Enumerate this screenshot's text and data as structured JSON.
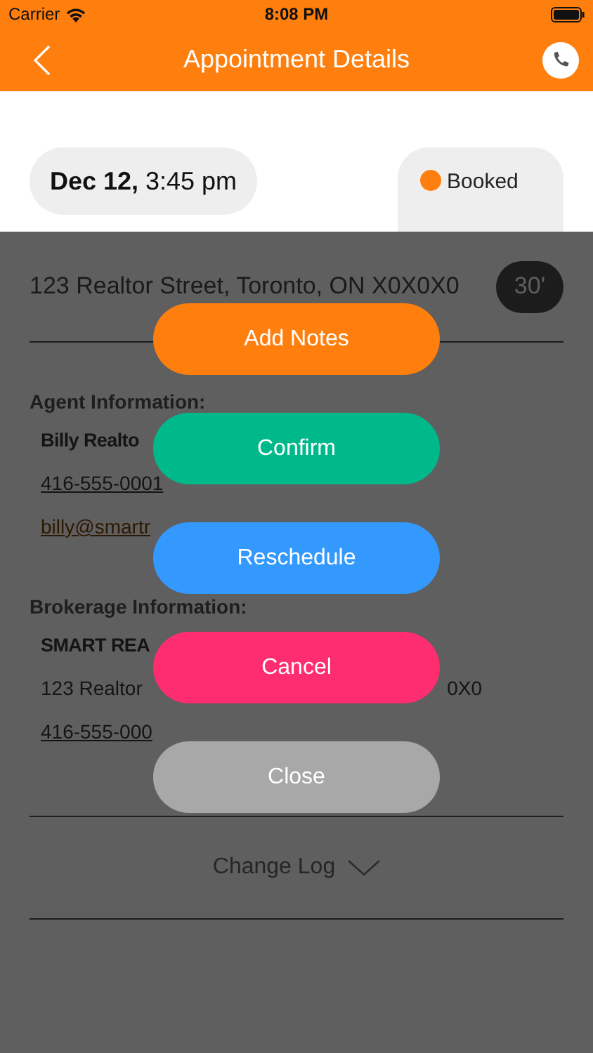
{
  "status_bar": {
    "carrier": "Carrier",
    "time": "8:08 PM"
  },
  "nav": {
    "title": "Appointment Details"
  },
  "appointment": {
    "when": "**Dec 12,** 3:45 pm",
    "status": {
      "label": "Booked",
      "color": "#ff7f0e"
    },
    "address": "123 Realtor Street, Toronto, ON X0X0X0",
    "duration": "30'"
  },
  "agent": {
    "heading": "Agent Information:",
    "name": "Billy Realto",
    "phone": "416-555-0001",
    "email": "billy@smartr"
  },
  "brokerage": {
    "heading": "Brokerage Information:",
    "name": "SMART REA",
    "address_start": "123 Realtor",
    "address_end": "0X0",
    "phone": "416-555-000"
  },
  "change_log": {
    "label": "Change Log",
    "expanded": false
  },
  "actions": [
    {
      "label": "Add Notes",
      "color": "#ff7f0e"
    },
    {
      "label": "Confirm",
      "color": "#00b98a"
    },
    {
      "label": "Reschedule",
      "color": "#3399fe"
    },
    {
      "label": "Cancel",
      "color": "#fe2d6f"
    },
    {
      "label": "Close",
      "color": "#a8a8a8"
    }
  ]
}
